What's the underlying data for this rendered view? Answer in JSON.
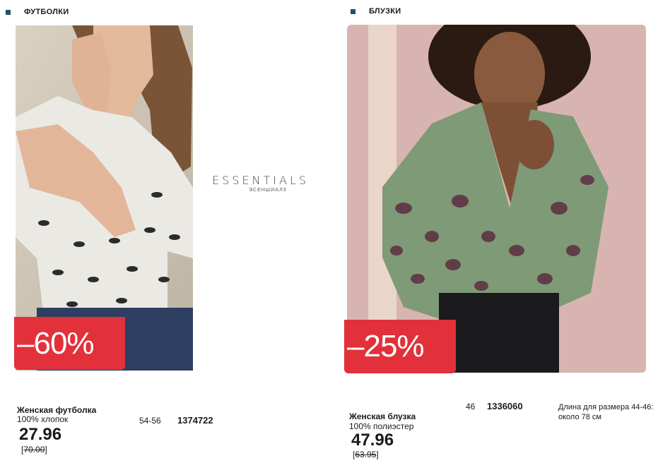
{
  "left": {
    "category": "ФУТБОЛКИ",
    "discount": "–60%",
    "product": {
      "name": "Женская футболка",
      "material": "100% хлопок",
      "price": "27.96",
      "old_price": "70.00",
      "sizes": "54-56",
      "code": "1374722"
    }
  },
  "right": {
    "category": "БЛУЗКИ",
    "discount": "–25%",
    "product": {
      "name": "Женская блузка",
      "material": "100% полиэстер",
      "price": "47.96",
      "old_price": "63.95",
      "sizes": "46",
      "code": "1336060",
      "note_line1": "Длина для размера 44-46:",
      "note_line2": "около 78 см"
    }
  },
  "brand": {
    "name": "ESSENTIALS",
    "subtitle": "ЭСЕНШИАЛЗ"
  },
  "colors": {
    "accent_red": "#e2313a",
    "marker_blue": "#1f4f6a"
  }
}
